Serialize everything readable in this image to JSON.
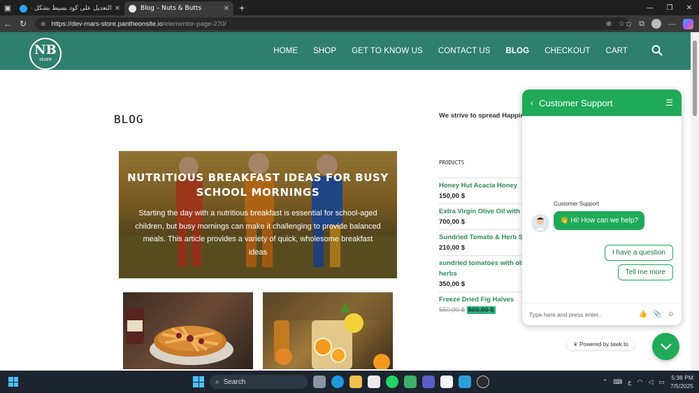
{
  "browser": {
    "tabs": [
      {
        "title": "التعديل على كود بسيط بشكل سريع",
        "active": false
      },
      {
        "title": "Blog – Nuts & Butts",
        "active": true
      }
    ],
    "url_host": "https://dev-mars-store.pantheonsite.io",
    "url_path": "/elementor-page-270/"
  },
  "site": {
    "logo_main": "NB",
    "logo_sub": "store",
    "nav": [
      "HOME",
      "SHOP",
      "GET TO KNOW US",
      "CONTACT US",
      "BLOG",
      "CHECKOUT",
      "CART"
    ],
    "current_nav": "BLOG"
  },
  "page": {
    "title": "BLOG",
    "hero_title": "NUTRITIOUS BREAKFAST IDEAS FOR BUSY SCHOOL MORNINGS",
    "hero_text": "Starting the day with a nutritious breakfast is essential for school-aged children, but busy mornings can make it challenging to provide balanced meals. This article provides a variety of quick, wholesome breakfast ideas"
  },
  "sidebar": {
    "tagline": "We strive to spread Happin",
    "products_heading": "PRODUCTS",
    "products": [
      {
        "name": "Honey Hut Acacia Honey",
        "price": "150,00 $"
      },
      {
        "name": "Extra Virgin Olive Oil with H",
        "price": "700,00 $"
      },
      {
        "name": "Sundried Tomato & Herb Sp",
        "price": "210,00 $"
      },
      {
        "name": "sundried tomatoes with oli herbs",
        "price": "350,00 $"
      },
      {
        "name": "Freeze Dried Fig Halves",
        "old_price": "550,00 $",
        "new_price": "500,00 $"
      }
    ]
  },
  "chat": {
    "title": "Customer Support",
    "agent_label": "Customer Support",
    "greeting": "👋 Hi! How can we help?",
    "quick_replies": [
      "I have a question",
      "Tell me more"
    ],
    "input_placeholder": "Type here and press enter..",
    "powered_by": "Powered by tawk.to",
    "accent": "#1faa59"
  },
  "taskbar": {
    "search_label": "Search",
    "time": "5:38 PM",
    "date": "7/5/2025",
    "lang": "ع"
  },
  "colors": {
    "header_bg": "#2e7f6b",
    "product_link": "#2e8b57"
  }
}
